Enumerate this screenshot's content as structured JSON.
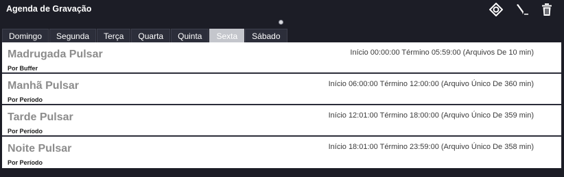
{
  "window": {
    "title": "Agenda de Gravação"
  },
  "toolbar": {
    "icons": [
      "target-icon",
      "edit-pen-icon",
      "trash-icon"
    ],
    "icon_color": "#ffffff"
  },
  "tabs": [
    {
      "label": "Domingo"
    },
    {
      "label": "Segunda"
    },
    {
      "label": "Terça"
    },
    {
      "label": "Quarta"
    },
    {
      "label": "Quinta"
    },
    {
      "label": "Sexta",
      "active": true
    },
    {
      "label": "Sábado"
    }
  ],
  "schedules": [
    {
      "name": "Madrugada Pulsar",
      "mode": "Por Buffer",
      "time": "Início 00:00:00 Término 05:59:00 (Arquivos De 10 min)"
    },
    {
      "name": "Manhã Pulsar",
      "mode": "Por Período",
      "time": "Início 06:00:00 Término 12:00:00 (Arquivo Único De 360 min)"
    },
    {
      "name": "Tarde Pulsar",
      "mode": "Por Período",
      "time": "Início 12:01:00 Término 18:00:00 (Arquivo Único De 359 min)"
    },
    {
      "name": "Noite Pulsar",
      "mode": "Por Período",
      "time": "Início 18:01:00 Término 23:59:00 (Arquivo Único De 358 min)"
    }
  ],
  "colors": {
    "background": "#1c1d26",
    "tab_active": "#c4c6cc",
    "row_name": "#8c8c8c"
  }
}
